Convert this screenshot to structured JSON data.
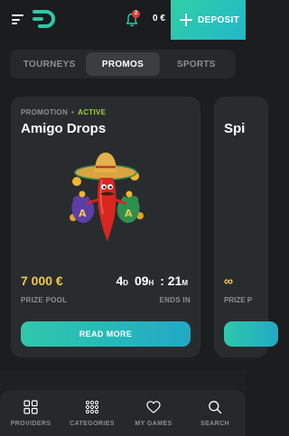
{
  "header": {
    "notification_count": "2",
    "balance": "0 €",
    "deposit_label": "DEPOSIT"
  },
  "tabs": [
    {
      "label": "TOURNEYS",
      "active": false
    },
    {
      "label": "PROMOS",
      "active": true
    },
    {
      "label": "SPORTS",
      "active": false
    }
  ],
  "promo_card": {
    "type": "PROMOTION",
    "status": "ACTIVE",
    "title": "Amigo Drops",
    "prize_pool": "7 000 €",
    "prize_pool_label": "PRIZE POOL",
    "timer": {
      "days": "4",
      "days_unit": "D",
      "hours": "09",
      "hours_unit": "H",
      "separator": ":",
      "minutes": "21",
      "minutes_unit": "M"
    },
    "ends_label": "ENDS IN",
    "button_label": "READ MORE"
  },
  "next_card": {
    "title_partial": "Spi",
    "prize_partial": "∞",
    "label_partial": "PRIZE P"
  },
  "bottom_nav": [
    {
      "label": "PROVIDERS",
      "icon": "grid-2x2-icon"
    },
    {
      "label": "CATEGORIES",
      "icon": "grid-3x3-dots-icon"
    },
    {
      "label": "MY GAMES",
      "icon": "heart-icon"
    },
    {
      "label": "SEARCH",
      "icon": "search-icon"
    }
  ],
  "colors": {
    "background": "#1b1d1e",
    "card": "#292c2e",
    "accent": "#2ec9a9",
    "accent2": "#21a9c6",
    "prize": "#f7c948",
    "status": "#9fd33a",
    "badge": "#e53935"
  }
}
